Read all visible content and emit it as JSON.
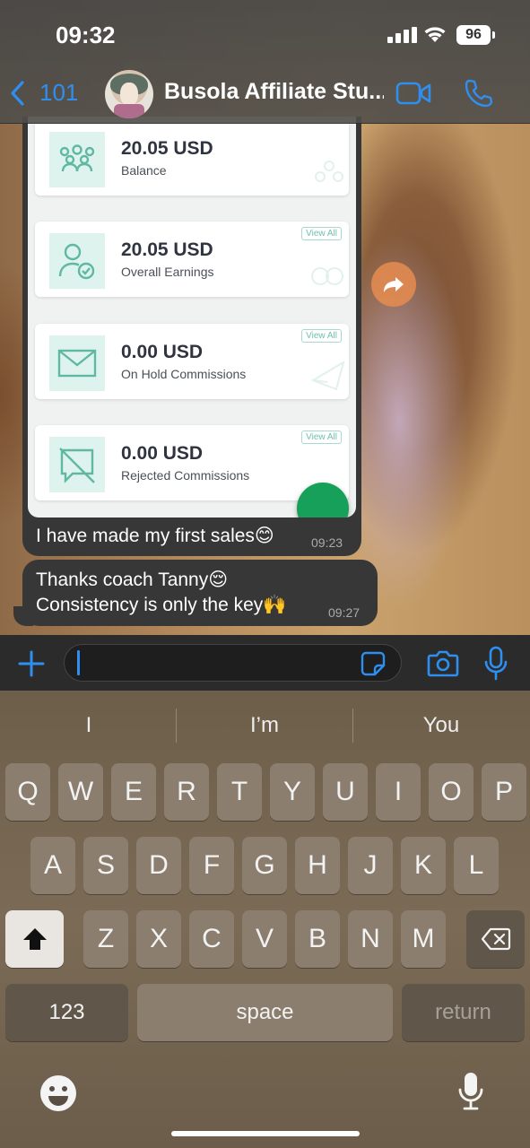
{
  "status_bar": {
    "time": "09:32",
    "battery": "96"
  },
  "header": {
    "back_count": "101",
    "chat_title": "Busola Affiliate Stu..."
  },
  "messages": {
    "image_message": {
      "cards": [
        {
          "amount": "20.05 USD",
          "label": "Balance",
          "view_all": ""
        },
        {
          "amount": "20.05 USD",
          "label": "Overall Earnings",
          "view_all": "View All"
        },
        {
          "amount": "0.00 USD",
          "label": "On Hold Commissions",
          "view_all": "View All"
        },
        {
          "amount": "0.00 USD",
          "label": "Rejected Commissions",
          "view_all": "View All"
        }
      ],
      "caption": "I have made my first sales😊",
      "time": "09:23"
    },
    "text_message": {
      "line1": "Thanks coach Tanny😌",
      "line2": "Consistency is only the key🙌",
      "time": "09:27"
    }
  },
  "input": {
    "value": ""
  },
  "keyboard": {
    "suggestions": [
      "I",
      "I’m",
      "You"
    ],
    "row1": [
      "Q",
      "W",
      "E",
      "R",
      "T",
      "Y",
      "U",
      "I",
      "O",
      "P"
    ],
    "row2": [
      "A",
      "S",
      "D",
      "F",
      "G",
      "H",
      "J",
      "K",
      "L"
    ],
    "row3": [
      "Z",
      "X",
      "C",
      "V",
      "B",
      "N",
      "M"
    ],
    "numbers_key": "123",
    "space_key": "space",
    "return_key": "return"
  },
  "colors": {
    "accent": "#2f8ff0",
    "teal_icon": "#5fb8a2",
    "bubble": "#373737"
  }
}
